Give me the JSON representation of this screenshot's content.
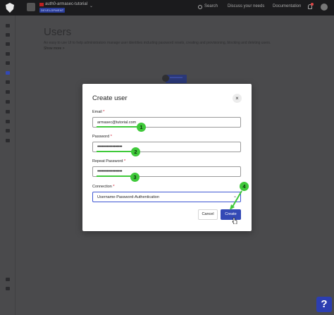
{
  "topbar": {
    "tenant_name": "auth0-armasec-tutorial",
    "env_badge": "DEVELOPMENT",
    "search_label": "Search",
    "discuss_label": "Discuss your needs",
    "docs_label": "Documentation"
  },
  "page": {
    "title": "Users",
    "description": "An easy to use UI to help administrators manage user identities including password resets, creating and provisioning, blocking and deleting users.",
    "show_more": "Show more >"
  },
  "modal": {
    "title": "Create user",
    "close_label": "×",
    "required_mark": "*",
    "email": {
      "label": "Email",
      "value": "armasec@tutorial.com"
    },
    "password": {
      "label": "Password",
      "value": "••••••••••••••••••"
    },
    "repeat_password": {
      "label": "Repeat Password",
      "value": "••••••••••••••••••"
    },
    "connection": {
      "label": "Connection",
      "value": "Username-Password-Authentication"
    },
    "cancel_label": "Cancel",
    "create_label": "Create"
  },
  "annotations": {
    "step1": "1",
    "step2": "2",
    "step3": "3",
    "step4": "4"
  },
  "help": {
    "label": "?"
  },
  "colors": {
    "accent": "#3349b5",
    "highlight": "#3fc93a",
    "danger": "#d0021b"
  },
  "icons": [
    "auth0-logo-icon",
    "search-icon",
    "bell-icon",
    "close-icon",
    "chevron-down-icon",
    "cursor-icon",
    "help-icon"
  ]
}
